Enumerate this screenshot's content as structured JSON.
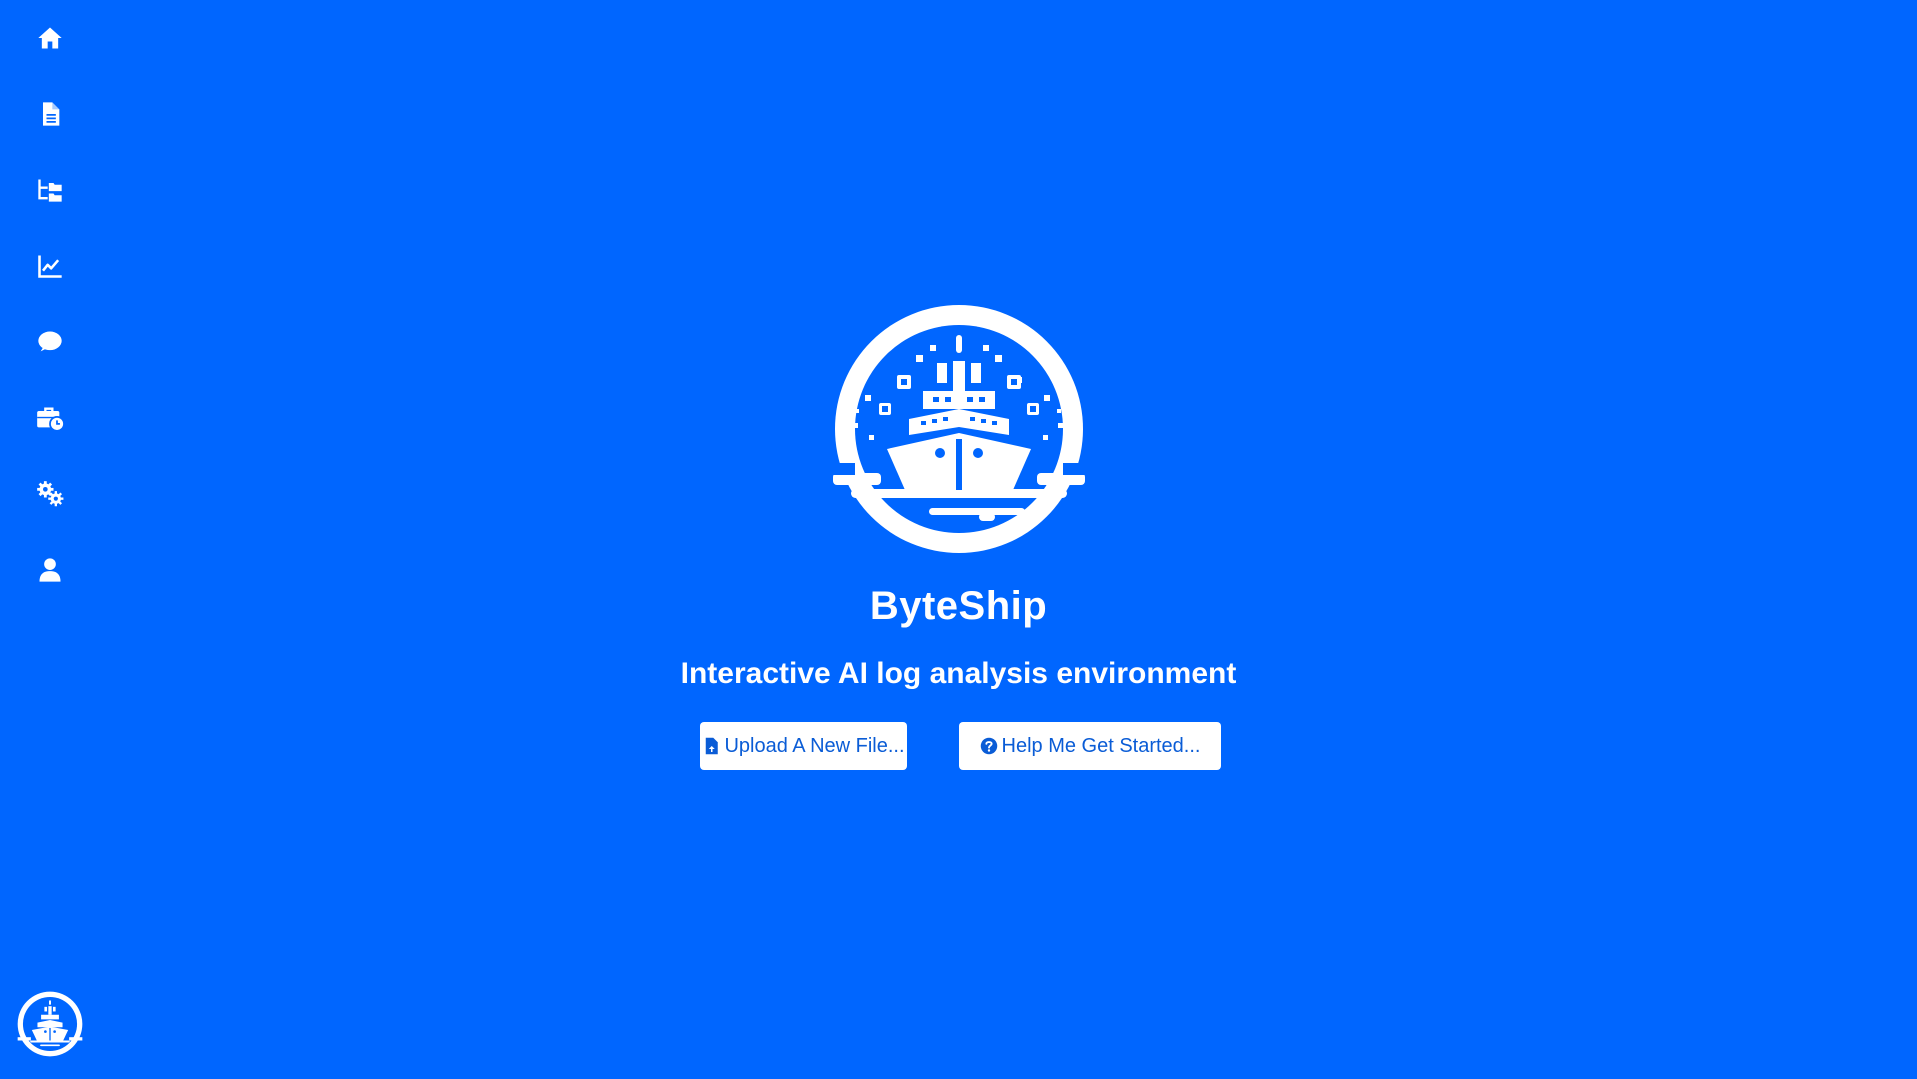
{
  "app": {
    "name": "ByteShip",
    "tagline": "Interactive AI log analysis environment"
  },
  "colors": {
    "background": "#0066ff",
    "foreground": "#ffffff",
    "button_text": "#0a5cd6"
  },
  "sidebar": {
    "items": [
      {
        "icon": "home-icon"
      },
      {
        "icon": "document-icon"
      },
      {
        "icon": "folder-tree-icon"
      },
      {
        "icon": "line-chart-icon"
      },
      {
        "icon": "chat-bubble-icon"
      },
      {
        "icon": "briefcase-clock-icon"
      },
      {
        "icon": "gears-icon"
      },
      {
        "icon": "user-icon"
      }
    ],
    "logo_icon": "byteship-logo-icon"
  },
  "actions": {
    "upload_label": "Upload A New File...",
    "upload_icon": "file-upload-icon",
    "help_label": "Help Me Get Started...",
    "help_icon": "question-circle-icon"
  }
}
